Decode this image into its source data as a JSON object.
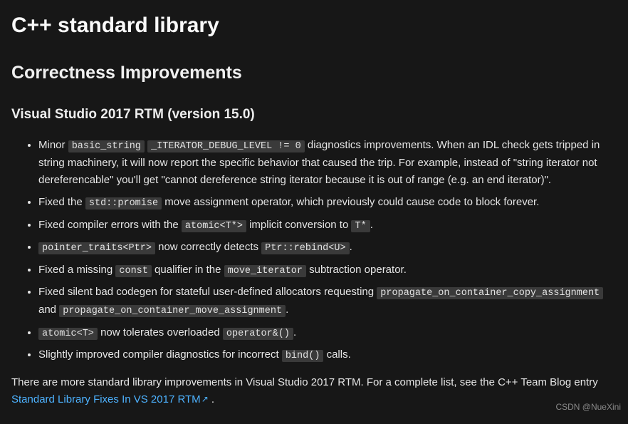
{
  "h1": "C++ standard library",
  "h2": "Correctness Improvements",
  "h3": "Visual Studio 2017 RTM (version 15.0)",
  "items": [
    {
      "parts": [
        {
          "t": "text",
          "v": "Minor "
        },
        {
          "t": "code",
          "v": "basic_string"
        },
        {
          "t": "text",
          "v": " "
        },
        {
          "t": "code",
          "v": "_ITERATOR_DEBUG_LEVEL != 0"
        },
        {
          "t": "text",
          "v": " diagnostics improvements. When an IDL check gets tripped in string machinery, it will now report the specific behavior that caused the trip. For example, instead of \"string iterator not dereferencable\" you'll get \"cannot dereference string iterator because it is out of range (e.g. an end iterator)\"."
        }
      ]
    },
    {
      "parts": [
        {
          "t": "text",
          "v": "Fixed the "
        },
        {
          "t": "code",
          "v": "std::promise"
        },
        {
          "t": "text",
          "v": " move assignment operator, which previously could cause code to block forever."
        }
      ]
    },
    {
      "parts": [
        {
          "t": "text",
          "v": "Fixed compiler errors with the "
        },
        {
          "t": "code",
          "v": "atomic<T*>"
        },
        {
          "t": "text",
          "v": " implicit conversion to "
        },
        {
          "t": "code",
          "v": "T*"
        },
        {
          "t": "text",
          "v": "."
        }
      ]
    },
    {
      "parts": [
        {
          "t": "code",
          "v": "pointer_traits<Ptr>"
        },
        {
          "t": "text",
          "v": " now correctly detects "
        },
        {
          "t": "code",
          "v": "Ptr::rebind<U>"
        },
        {
          "t": "text",
          "v": "."
        }
      ]
    },
    {
      "parts": [
        {
          "t": "text",
          "v": "Fixed a missing "
        },
        {
          "t": "code",
          "v": "const"
        },
        {
          "t": "text",
          "v": " qualifier in the "
        },
        {
          "t": "code",
          "v": "move_iterator"
        },
        {
          "t": "text",
          "v": " subtraction operator."
        }
      ]
    },
    {
      "parts": [
        {
          "t": "text",
          "v": "Fixed silent bad codegen for stateful user-defined allocators requesting "
        },
        {
          "t": "code",
          "v": "propagate_on_container_copy_assignment"
        },
        {
          "t": "text",
          "v": " and "
        },
        {
          "t": "code",
          "v": "propagate_on_container_move_assignment"
        },
        {
          "t": "text",
          "v": "."
        }
      ]
    },
    {
      "parts": [
        {
          "t": "code",
          "v": "atomic<T>"
        },
        {
          "t": "text",
          "v": " now tolerates overloaded "
        },
        {
          "t": "code",
          "v": "operator&()"
        },
        {
          "t": "text",
          "v": "."
        }
      ]
    },
    {
      "parts": [
        {
          "t": "text",
          "v": "Slightly improved compiler diagnostics for incorrect "
        },
        {
          "t": "code",
          "v": "bind()"
        },
        {
          "t": "text",
          "v": " calls."
        }
      ]
    }
  ],
  "footer_pre": "There are more standard library improvements in Visual Studio 2017 RTM. For a complete list, see the C++ Team Blog entry ",
  "footer_link": "Standard Library Fixes In VS 2017 RTM",
  "footer_post": " .",
  "watermark": "CSDN @NueXini"
}
